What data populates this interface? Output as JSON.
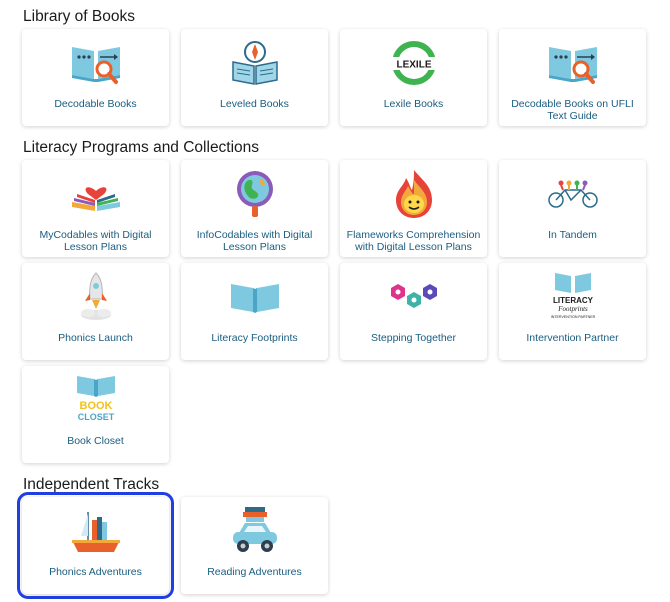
{
  "sections": [
    {
      "title": "Library of Books",
      "cards": [
        {
          "label": "Decodable Books",
          "icon": "book-magnifier-icon"
        },
        {
          "label": "Leveled Books",
          "icon": "compass-book-icon"
        },
        {
          "label": "Lexile Books",
          "icon": "lexile-logo-icon",
          "logo_text": "LEXILE"
        },
        {
          "label": "Decodable Books on UFLI Text Guide",
          "icon": "book-magnifier-icon"
        }
      ]
    },
    {
      "title": "Literacy Programs and Collections",
      "cards": [
        {
          "label": "MyCodables with Digital Lesson Plans",
          "icon": "heart-book-icon"
        },
        {
          "label": "InfoCodables with Digital Lesson Plans",
          "icon": "globe-magnifier-icon"
        },
        {
          "label": "Flameworks Comprehension with Digital Lesson Plans",
          "icon": "flame-icon"
        },
        {
          "label": "In Tandem",
          "icon": "tandem-bicycle-icon"
        },
        {
          "label": "Phonics Launch",
          "icon": "rocket-icon"
        },
        {
          "label": "Literacy Footprints",
          "icon": "open-book-icon"
        },
        {
          "label": "Stepping Together",
          "icon": "hexagons-icon"
        },
        {
          "label": "Intervention Partner",
          "icon": "literacy-footprints-logo-icon",
          "logo_text": [
            "LITERACY",
            "Footprints",
            "INTERVENTION PARTNER"
          ]
        },
        {
          "label": "Book Closet",
          "icon": "book-closet-logo-icon",
          "logo_text": [
            "BOOK",
            "CLOSET"
          ]
        }
      ]
    },
    {
      "title": "Independent Tracks",
      "cards": [
        {
          "label": "Phonics Adventures",
          "icon": "boat-books-icon",
          "selected": true
        },
        {
          "label": "Reading Adventures",
          "icon": "car-books-icon"
        }
      ]
    }
  ],
  "colors": {
    "label": "#1a5d80",
    "selection_outline": "#1f3fe0",
    "book_blue": "#7fc9e0",
    "magnifier_orange": "#e8602c"
  }
}
